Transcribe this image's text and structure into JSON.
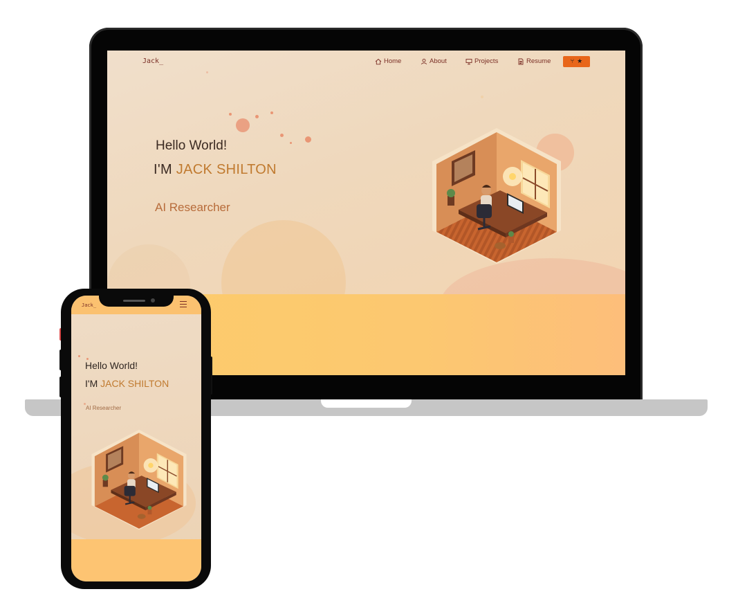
{
  "desktop": {
    "logo": "Jack_",
    "nav": {
      "home": "Home",
      "about": "About",
      "projects": "Projects",
      "resume": "Resume"
    },
    "github_button_icon": "github-fork-icon",
    "github_star_icon": "star-icon",
    "hero": {
      "greeting": "Hello World!",
      "im": "I'M ",
      "name": "JACK SHILTON",
      "role": "AI Researcher"
    }
  },
  "mobile": {
    "logo": "Jack_",
    "menu_icon": "hamburger-icon",
    "hero": {
      "greeting": "Hello World!",
      "im": "I'M ",
      "name": "JACK SHILTON",
      "role": "AI Researcher"
    }
  },
  "colors": {
    "accent_orange": "#e8661a",
    "name_gold": "#c07a2f",
    "nav_text": "#7a2e25",
    "band": "#fdcc6b"
  }
}
